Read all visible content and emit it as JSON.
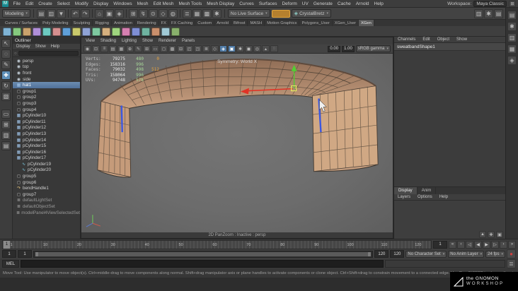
{
  "menu_bar": {
    "menus": [
      "File",
      "Edit",
      "Create",
      "Select",
      "Modify",
      "Display",
      "Windows",
      "Mesh",
      "Edit Mesh",
      "Mesh Tools",
      "Mesh Display",
      "Curves",
      "Surfaces",
      "Deform",
      "UV",
      "Generate",
      "Cache",
      "Arnold",
      "Help"
    ],
    "workspace_label": "Workspace:",
    "workspace_value": "Maya Classic"
  },
  "status_line": {
    "mode": "Modeling",
    "live_surface": "No Live Surface",
    "custom_menu": "CrystalBretz",
    "groups": [
      [
        {
          "name": "new-scene-icon",
          "glyph": "▤"
        },
        {
          "name": "open-scene-icon",
          "glyph": "▥"
        },
        {
          "name": "save-scene-icon",
          "glyph": "▼"
        }
      ],
      [
        {
          "name": "undo-icon",
          "glyph": "↶"
        },
        {
          "name": "redo-icon",
          "glyph": "↷"
        }
      ],
      [
        {
          "name": "select-by-hierarchy-icon",
          "glyph": "⌂"
        },
        {
          "name": "select-by-object-icon",
          "glyph": "▣"
        },
        {
          "name": "select-by-component-icon",
          "glyph": "◈"
        }
      ],
      [
        {
          "name": "snap-to-grid-icon",
          "glyph": "⊞"
        },
        {
          "name": "snap-to-curve-icon",
          "glyph": "↯"
        },
        {
          "name": "snap-to-point-icon",
          "glyph": "⊙"
        },
        {
          "name": "snap-to-plane-icon",
          "glyph": "◇"
        },
        {
          "name": "make-live-icon",
          "glyph": "◍"
        }
      ],
      [
        {
          "name": "construction-history-icon",
          "glyph": "≣"
        },
        {
          "name": "render-frame-icon",
          "glyph": "▦"
        },
        {
          "name": "ipr-render-icon",
          "glyph": "▩"
        },
        {
          "name": "render-settings-icon",
          "glyph": "✱"
        }
      ]
    ],
    "right_icons": [
      {
        "name": "sidebar-attribute-editor-icon",
        "glyph": "▥"
      },
      {
        "name": "sidebar-tool-settings-icon",
        "glyph": "✱"
      },
      {
        "name": "sidebar-channel-box-icon",
        "glyph": "▤"
      }
    ]
  },
  "shelf": {
    "active_tab": "XGen",
    "tabs": [
      "Curves / Surfaces",
      "Poly Modeling",
      "Sculpting",
      "Rigging",
      "Animation",
      "Rendering",
      "FX",
      "FX Caching",
      "Custom",
      "Arnold",
      "Bifrost",
      "MASH",
      "Motion Graphics",
      "Polygons_User",
      "XGen_User",
      "XGen"
    ],
    "icons": [
      {
        "name": "shelf-sphere-icon",
        "color": "#7fb3d5"
      },
      {
        "name": "shelf-cube-icon",
        "color": "#85c97e"
      },
      {
        "name": "shelf-cylinder-icon",
        "color": "#c9a26c"
      },
      {
        "name": "shelf-cone-icon",
        "color": "#b08fd8"
      },
      {
        "name": "shelf-plane-icon",
        "color": "#6cc9c0"
      },
      {
        "name": "shelf-torus-icon",
        "color": "#d58f8f"
      },
      {
        "name": "shelf-curve-icon",
        "color": "#5f9fd8"
      },
      {
        "name": "shelf-text-icon",
        "color": "#c9c96c"
      },
      {
        "name": "shelf-boolean-icon",
        "color": "#8fa3d5"
      },
      {
        "name": "shelf-extrude-icon",
        "color": "#7ec9a0"
      },
      {
        "name": "shelf-bevel-icon",
        "color": "#d5b07f"
      },
      {
        "name": "shelf-bridge-icon",
        "color": "#9fd57f"
      },
      {
        "name": "shelf-multicut-icon",
        "color": "#d57fb0"
      },
      {
        "name": "shelf-mirror-icon",
        "color": "#7f8fd5"
      },
      {
        "name": "shelf-smooth-icon",
        "color": "#6fb3a0"
      },
      {
        "name": "shelf-lattice-icon",
        "color": "#c98f6c"
      },
      {
        "name": "shelf-wedge-icon",
        "color": "#a0c9d5"
      },
      {
        "name": "shelf-quad-draw-icon",
        "color": "#89b06c"
      }
    ]
  },
  "tool_box": {
    "tools": [
      {
        "name": "select-tool-icon",
        "glyph": "↖"
      },
      {
        "name": "lasso-tool-icon",
        "glyph": "◌"
      },
      {
        "name": "paint-select-tool-icon",
        "glyph": "✎"
      },
      {
        "name": "move-tool-icon",
        "glyph": "✚",
        "active": true
      },
      {
        "name": "rotate-tool-icon",
        "glyph": "↻"
      },
      {
        "name": "scale-tool-icon",
        "glyph": "▧"
      }
    ],
    "layouts": [
      {
        "name": "single-pane-layout-icon",
        "glyph": "▭"
      },
      {
        "name": "four-pane-layout-icon",
        "glyph": "⊞"
      },
      {
        "name": "pane-outliner-layout-icon",
        "glyph": "▥"
      },
      {
        "name": "pane-hypergraph-layout-icon",
        "glyph": "▤"
      }
    ]
  },
  "outliner": {
    "title": "Outliner",
    "menus": [
      "Display",
      "Show",
      "Help"
    ],
    "items": [
      {
        "label": "persp",
        "icon": "camera"
      },
      {
        "label": "top",
        "icon": "camera"
      },
      {
        "label": "front",
        "icon": "camera"
      },
      {
        "label": "side",
        "icon": "camera"
      },
      {
        "label": "hat1",
        "icon": "mesh",
        "selected": true
      },
      {
        "label": "group1",
        "icon": "group"
      },
      {
        "label": "group2",
        "icon": "group"
      },
      {
        "label": "group3",
        "icon": "group"
      },
      {
        "label": "group4",
        "icon": "group"
      },
      {
        "label": "pCylinder10",
        "icon": "mesh"
      },
      {
        "label": "pCylinder11",
        "icon": "mesh"
      },
      {
        "label": "pCylinder12",
        "icon": "mesh"
      },
      {
        "label": "pCylinder13",
        "icon": "mesh"
      },
      {
        "label": "pCylinder14",
        "icon": "mesh"
      },
      {
        "label": "pCylinder15",
        "icon": "mesh"
      },
      {
        "label": "pCylinder16",
        "icon": "mesh"
      },
      {
        "label": "pCylinder17",
        "icon": "mesh"
      },
      {
        "label": "pCylinder19",
        "icon": "curve",
        "indent": 1
      },
      {
        "label": "pCylinder20",
        "icon": "curve",
        "indent": 1
      },
      {
        "label": "group5",
        "icon": "group"
      },
      {
        "label": "group6",
        "icon": "group"
      },
      {
        "label": "bendHandle1",
        "icon": "handle"
      },
      {
        "label": "group7",
        "icon": "group"
      },
      {
        "label": "defaultLightSet",
        "icon": "set",
        "dim": true
      },
      {
        "label": "defaultObjectSet",
        "icon": "set",
        "dim": true
      },
      {
        "label": "modelPanel4ViewSelectedSet",
        "icon": "set",
        "dim": true
      }
    ]
  },
  "viewport": {
    "panel_menus": [
      "View",
      "Shading",
      "Lighting",
      "Show",
      "Renderer",
      "Panels"
    ],
    "toolbar": {
      "icons": [
        {
          "name": "camera-select-icon",
          "glyph": "◉"
        },
        {
          "name": "camera-lock-icon",
          "glyph": "⊡"
        },
        {
          "name": "camera-attributes-icon",
          "glyph": "≡"
        },
        {
          "name": "bookmarks-icon",
          "glyph": "▤"
        },
        {
          "name": "image-plane-icon",
          "glyph": "▦"
        },
        {
          "name": "two-d-pan-zoom-icon",
          "glyph": "⊕"
        },
        {
          "name": "grease-pencil-icon",
          "glyph": "✎"
        },
        {
          "name": "grid-toggle-icon",
          "glyph": "⊞"
        },
        {
          "name": "film-gate-icon",
          "glyph": "▭"
        },
        {
          "name": "resolution-gate-icon",
          "glyph": "◻"
        },
        {
          "name": "gate-mask-icon",
          "glyph": "▩"
        },
        {
          "name": "field-chart-icon",
          "glyph": "⊟"
        },
        {
          "name": "safe-action-icon",
          "glyph": "◰"
        },
        {
          "name": "safe-title-icon",
          "glyph": "◳"
        },
        {
          "name": "hud-toggle-icon",
          "glyph": "≣"
        },
        {
          "name": "xray-icon",
          "glyph": "◇"
        },
        {
          "name": "wireframe-on-shaded-icon",
          "glyph": "◈",
          "active": true
        },
        {
          "name": "textured-mode-icon",
          "glyph": "▣",
          "active": true
        },
        {
          "name": "used-lights-icon",
          "glyph": "✱"
        },
        {
          "name": "shadows-icon",
          "glyph": "◼"
        },
        {
          "name": "occlusion-icon",
          "glyph": "◎"
        },
        {
          "name": "anti-alias-icon",
          "glyph": "▴"
        },
        {
          "name": "isolate-select-icon",
          "glyph": "◌"
        }
      ],
      "exposure": "0.00",
      "gamma": "1.00",
      "view_transform": "sRGB gamma"
    },
    "hud": {
      "rows": [
        {
          "label": "Verts:",
          "values": [
            "79275",
            "480",
            "0"
          ]
        },
        {
          "label": "Edges:",
          "values": [
            "158316",
            "996",
            ""
          ]
        },
        {
          "label": "Faces:",
          "values": [
            "79032",
            "498",
            "512"
          ]
        },
        {
          "label": "Tris:",
          "values": [
            "158064",
            "996",
            ""
          ]
        },
        {
          "label": "UVs:",
          "values": [
            "94748",
            "578",
            ""
          ]
        }
      ]
    },
    "symmetry": "Symmetry: World X",
    "camera_label": "2D PanZoom : Inactive : persp"
  },
  "channel_box": {
    "menus": [
      "Channels",
      "Edit",
      "Object",
      "Show"
    ],
    "object_name": "sweatbandShape1"
  },
  "display_panel": {
    "tabs": [
      "Display",
      "Anim"
    ],
    "active_tab": "Display",
    "menus": [
      "Layers",
      "Options",
      "Help"
    ],
    "icons": [
      {
        "name": "move-layer-up-icon",
        "glyph": "▲"
      },
      {
        "name": "new-layer-icon",
        "glyph": "✚"
      },
      {
        "name": "new-layer-from-selected-icon",
        "glyph": "▣"
      }
    ]
  },
  "right_strip": {
    "icons": [
      {
        "name": "attribute-editor-tab-icon",
        "glyph": "▤"
      },
      {
        "name": "tool-settings-tab-icon",
        "glyph": "✱"
      },
      {
        "name": "channel-box-tab-icon",
        "glyph": "▥"
      },
      {
        "name": "modeling-toolkit-tab-icon",
        "glyph": "▦"
      },
      {
        "name": "xgen-tab-icon",
        "glyph": "◈"
      }
    ]
  },
  "timeline": {
    "labels": [
      "1",
      "10",
      "20",
      "30",
      "40",
      "50",
      "60",
      "70",
      "80",
      "90",
      "100",
      "110",
      "120"
    ],
    "current": "1",
    "playback": [
      {
        "name": "go-to-start-button",
        "glyph": "«"
      },
      {
        "name": "step-back-frame-button",
        "glyph": "‹"
      },
      {
        "name": "step-back-key-button",
        "glyph": "◁"
      },
      {
        "name": "play-backwards-button",
        "glyph": "◀"
      },
      {
        "name": "play-forwards-button",
        "glyph": "▶"
      },
      {
        "name": "step-forward-key-button",
        "glyph": "▷"
      },
      {
        "name": "step-forward-frame-button",
        "glyph": "›"
      },
      {
        "name": "go-to-end-button",
        "glyph": "»"
      }
    ]
  },
  "range_slider": {
    "playback_start": "1",
    "anim_start": "1",
    "anim_end": "120",
    "playback_end": "120",
    "character_set": "No Character Set",
    "anim_layer": "No Anim Layer",
    "fps": "24 fps"
  },
  "command_line": {
    "label": "MEL"
  },
  "help_line": {
    "text": "Move Tool: Use manipulator to move object(s). Ctrl+middle-drag to move components along normal. Shift+drag manipulator axis or plane handles to activate components or clone object. Ctrl+Shift+drag to constrain movement to a connected edge. Use D or INSERT to change the pivot position and axis orientation."
  },
  "gnomon": {
    "line1": "the GNOMON",
    "line2": "WORKSHOP"
  },
  "colors": {
    "selection_blue": "#3b57e0",
    "band_tan": "#c79f80",
    "manipulator_red": "#e03326",
    "manipulator_green": "#53cd33"
  }
}
